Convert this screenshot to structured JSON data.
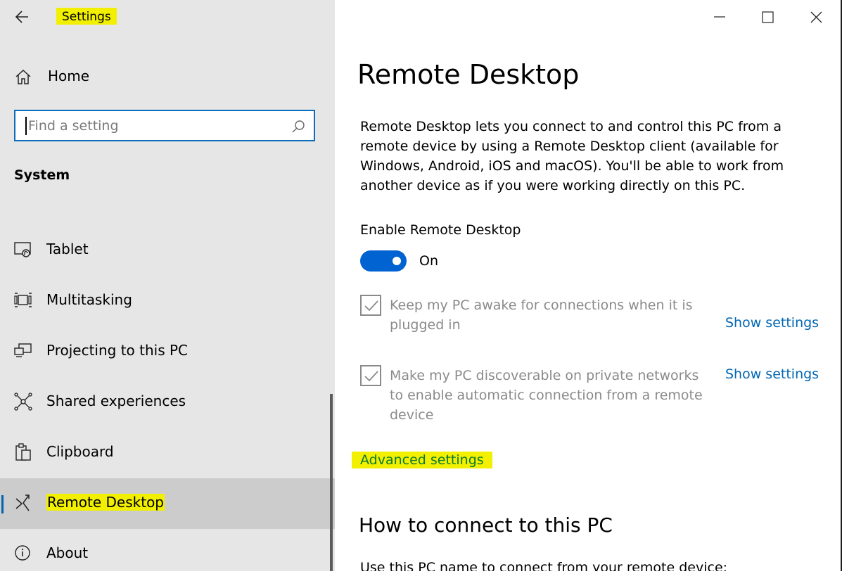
{
  "window": {
    "title": "Settings",
    "controls": [
      "minimize",
      "maximize",
      "close"
    ]
  },
  "sidebar": {
    "home_label": "Home",
    "search": {
      "placeholder": "Find a setting",
      "value": ""
    },
    "section_title": "System",
    "items": [
      {
        "label": "Tablet",
        "icon": "tablet-icon"
      },
      {
        "label": "Multitasking",
        "icon": "multitasking-icon"
      },
      {
        "label": "Projecting to this PC",
        "icon": "projecting-icon"
      },
      {
        "label": "Shared experiences",
        "icon": "shared-experiences-icon"
      },
      {
        "label": "Clipboard",
        "icon": "clipboard-icon"
      },
      {
        "label": "Remote Desktop",
        "icon": "remote-desktop-icon",
        "active": true
      },
      {
        "label": "About",
        "icon": "info-icon"
      }
    ]
  },
  "main": {
    "title": "Remote Desktop",
    "description": "Remote Desktop lets you connect to and control this PC from a remote device by using a Remote Desktop client (available for Windows, Android, iOS and macOS). You'll be able to work from another device as if you were working directly on this PC.",
    "enable_label": "Enable Remote Desktop",
    "toggle_state": "On",
    "options": [
      {
        "label": "Keep my PC awake for connections when it is plugged in",
        "checked": true,
        "link": "Show settings"
      },
      {
        "label": "Make my PC discoverable on private networks to enable automatic connection from a remote device",
        "checked": true,
        "link": "Show settings"
      }
    ],
    "advanced_link": "Advanced settings",
    "how_to_heading": "How to connect to this PC",
    "how_to_text": "Use this PC name to connect from your remote device:"
  },
  "colors": {
    "accent": "#0063d1",
    "link": "#0066b4",
    "highlight": "#f2f000",
    "sidebar_bg": "#e6e6e6",
    "active_item_bg": "#cccccc"
  }
}
